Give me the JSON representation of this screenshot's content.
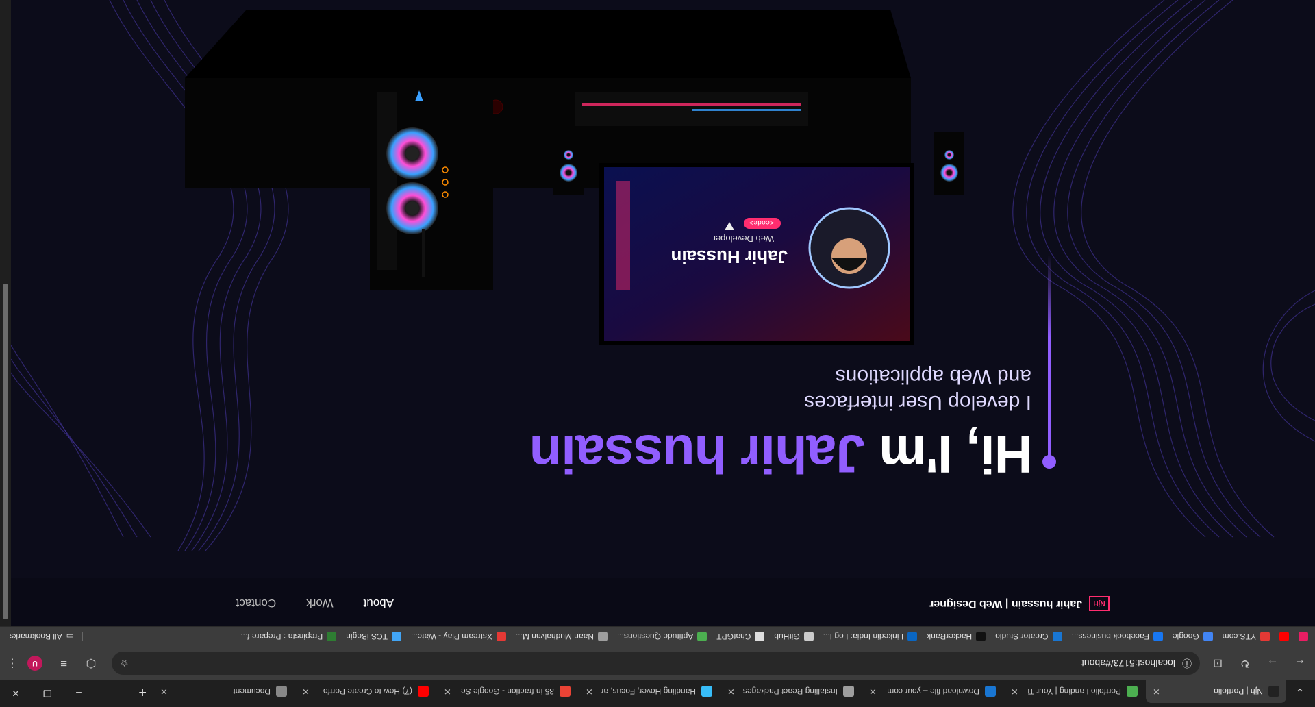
{
  "tabs": [
    {
      "title": "Njh | Portfolio",
      "active": true,
      "color": "#222222"
    },
    {
      "title": "Portfolio Landing | Your Ti",
      "color": "#4caf50"
    },
    {
      "title": "Download file – your com",
      "color": "#1976d2"
    },
    {
      "title": "Installing React Packages",
      "color": "#9e9e9e"
    },
    {
      "title": "Handling Hover, Focus, ar",
      "color": "#38bdf8"
    },
    {
      "title": "35 in fraction - Google Se",
      "color": "#ea4335"
    },
    {
      "title": "(7) How to Create Portfo",
      "color": "#ff0000"
    },
    {
      "title": "Document",
      "color": "#888888"
    }
  ],
  "address": {
    "url": "localhost:5173/#about"
  },
  "profile_initial": "U",
  "bookmarks": [
    {
      "label": "",
      "color": "#e91e63"
    },
    {
      "label": "",
      "color": "#ff0000"
    },
    {
      "label": "YTS.com",
      "color": "#e53935"
    },
    {
      "label": "Google",
      "color": "#4285f4"
    },
    {
      "label": "Facebook business...",
      "color": "#1877f2"
    },
    {
      "label": "Creator Studio",
      "color": "#1976d2"
    },
    {
      "label": "HackerRank",
      "color": "#111111"
    },
    {
      "label": "Linkedin India: Log I...",
      "color": "#0a66c2"
    },
    {
      "label": "GitHub",
      "color": "#cccccc"
    },
    {
      "label": "ChatGPT",
      "color": "#dddddd"
    },
    {
      "label": "Aptitude Questions...",
      "color": "#4caf50"
    },
    {
      "label": "Naan Mudhalvan M...",
      "color": "#9e9e9e"
    },
    {
      "label": "Xstream Play - Watc...",
      "color": "#e53935"
    },
    {
      "label": "TCS iBegin",
      "color": "#42a5f5"
    },
    {
      "label": "Prepinsta : Prepare f...",
      "color": "#2e7d32"
    }
  ],
  "all_bookmarks": "All Bookmarks",
  "nav": {
    "logo": "NjH",
    "brand": "Jahir hussain | Web Designer",
    "links": [
      "About",
      "Work",
      "Contact"
    ]
  },
  "hero": {
    "greeting": "Hi, I'm ",
    "name": "Jahir hussain",
    "line1": "I develop User interfaces",
    "line2": "and Web applications"
  },
  "monitor": {
    "name": "Jahir Hussain",
    "role": "Web Developer",
    "code_badge": "<code>"
  },
  "colors": {
    "accent": "#915eff",
    "background": "#0c0c1a",
    "navbar": "#0a0a16"
  }
}
